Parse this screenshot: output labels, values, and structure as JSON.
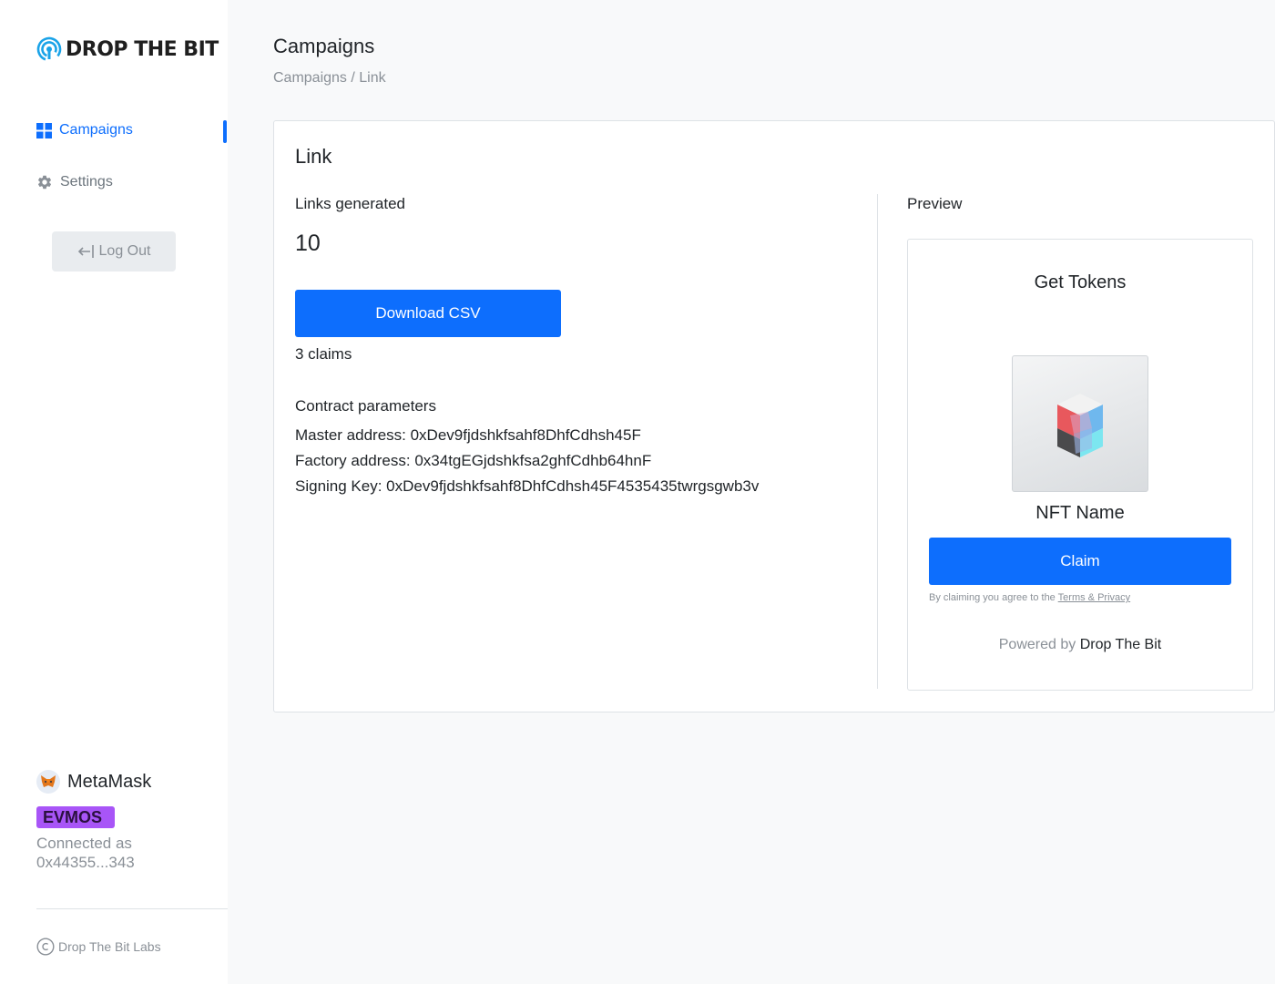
{
  "brand": {
    "logo_text": "DROP THE BIT",
    "accent": "#0d6efd"
  },
  "sidebar": {
    "nav": [
      {
        "label": "Campaigns",
        "icon": "grid-icon",
        "active": true
      },
      {
        "label": "Settings",
        "icon": "gear-icon",
        "active": false
      }
    ],
    "logout_label": "Log Out",
    "wallet": {
      "name": "MetaMask",
      "chain": "EVMOS",
      "connected_prefix": "Connected as",
      "address": "0x44355...343"
    },
    "copyright": "Drop The Bit Labs"
  },
  "header": {
    "title": "Campaigns",
    "breadcrumb": "Campaigns / Link"
  },
  "card": {
    "title": "Link",
    "links_generated_label": "Links generated",
    "links_generated_value": "10",
    "download_label": "Download CSV",
    "claims": "3 claims",
    "params_title": "Contract parameters",
    "master_address": "Master address: 0xDev9fjdshkfsahf8DhfCdhsh45F",
    "factory_address": "Factory address: 0x34tgEGjdshkfsa2ghfCdhb64hnF",
    "signing_key": "Signing Key: 0xDev9fjdshkfsahf8DhfCdhsh45F4535435twrgsgwb3v"
  },
  "preview": {
    "label": "Preview",
    "title": "Get Tokens",
    "nft_name": "NFT Name",
    "claim_label": "Claim",
    "terms_prefix": "By claiming you agree to the",
    "terms_link": "Terms & Privacy",
    "powered_prefix": "Powered by",
    "powered_brand": "Drop The Bit"
  }
}
